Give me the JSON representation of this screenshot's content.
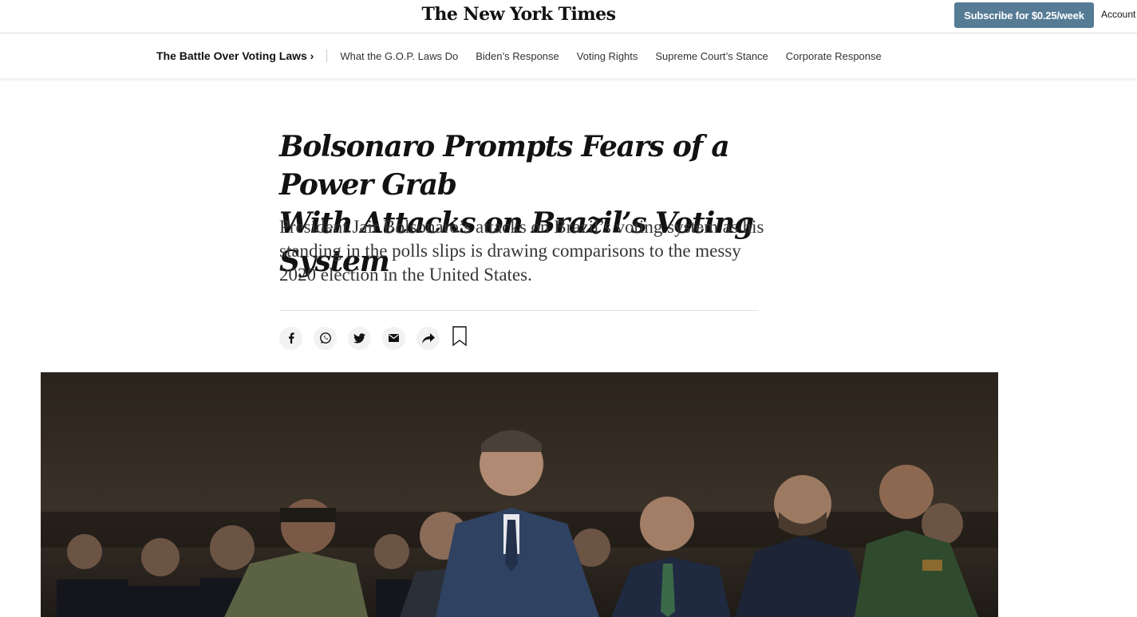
{
  "header": {
    "masthead": "The New York Times",
    "subscribe_label": "Subscribe for $0.25/week",
    "account_label": "Account"
  },
  "section_nav": {
    "title": "The Battle Over Voting Laws ›",
    "links": [
      "What the G.O.P. Laws Do",
      "Biden’s Response",
      "Voting Rights",
      "Supreme Court’s Stance",
      "Corporate Response"
    ]
  },
  "article": {
    "headline_line1": "Bolsonaro Prompts Fears of a Power Grab",
    "headline_line2": "With Attacks on Brazil’s Voting System",
    "summary": "President Jair Bolsonaro’s attacks on Brazil’s voting system as his standing in the polls slips is drawing comparisons to the messy 2020 election in the United States."
  },
  "share_icons": [
    "facebook-icon",
    "whatsapp-icon",
    "twitter-icon",
    "email-icon",
    "share-icon",
    "bookmark-icon"
  ],
  "colors": {
    "subscribe_bg": "#567b95",
    "text": "#121212",
    "share_bg": "#f2f2f2"
  }
}
